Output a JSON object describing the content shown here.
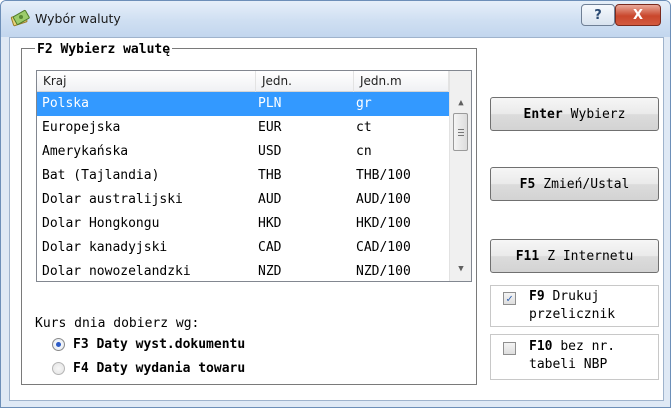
{
  "window": {
    "title": "Wybór waluty",
    "help_label": "?",
    "close_label": "X"
  },
  "group": {
    "title": "F2 Wybierz walutę"
  },
  "table": {
    "columns": [
      "Kraj",
      "Jedn.",
      "Jedn.m"
    ],
    "rows": [
      [
        "Polska",
        "PLN",
        "gr"
      ],
      [
        "Europejska",
        "EUR",
        "ct"
      ],
      [
        "Amerykańska",
        "USD",
        "cn"
      ],
      [
        "Bat (Tajlandia)",
        "THB",
        "THB/100"
      ],
      [
        "Dolar australijski",
        "AUD",
        "AUD/100"
      ],
      [
        "Dolar Hongkongu",
        "HKD",
        "HKD/100"
      ],
      [
        "Dolar kanadyjski",
        "CAD",
        "CAD/100"
      ],
      [
        "Dolar nowozelandzki",
        "NZD",
        "NZD/100"
      ]
    ],
    "selected_row": 0
  },
  "kurs": {
    "label": "Kurs dnia dobierz wg:",
    "options": [
      {
        "key": "F3",
        "label": "Daty wyst.dokumentu",
        "selected": true
      },
      {
        "key": "F4",
        "label": "Daty wydania towaru",
        "selected": false
      }
    ]
  },
  "buttons": {
    "enter": {
      "key": "Enter",
      "label": "Wybierz"
    },
    "f5": {
      "key": "F5",
      "label": "Zmień/Ustal"
    },
    "f11": {
      "key": "F11",
      "label": "Z Internetu"
    }
  },
  "checkboxes": {
    "f9": {
      "key": "F9",
      "line1": "Drukuj",
      "line2": "przelicznik",
      "checked": true
    },
    "f10": {
      "key": "F10",
      "line1": "bez nr.",
      "line2": "tabeli NBP",
      "checked": false
    }
  },
  "colors": {
    "selection": "#3399ff",
    "radio_dot": "#2c5bc7",
    "close_button": "#c9472c"
  }
}
